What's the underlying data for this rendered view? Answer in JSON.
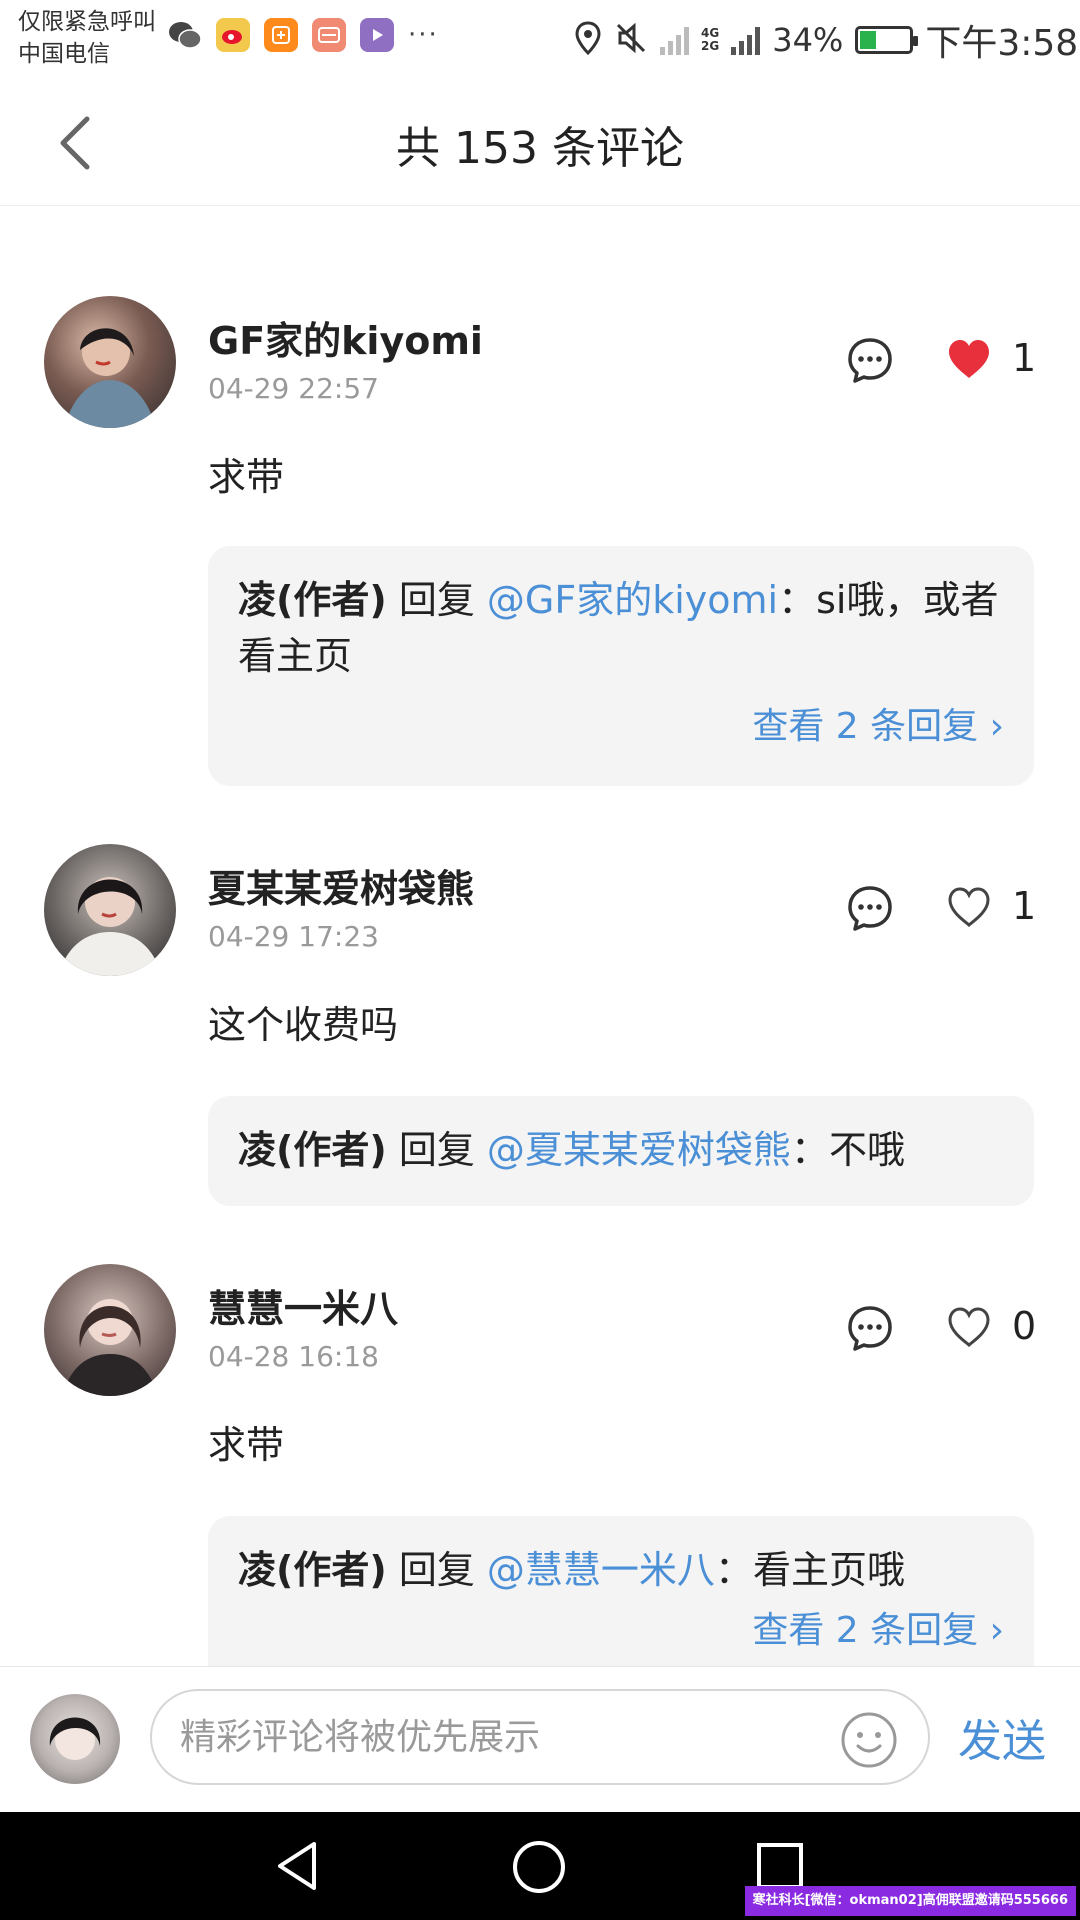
{
  "status_bar": {
    "carrier_line1": "仅限紧急呼叫",
    "carrier_line2": "中国电信",
    "notification_icons": [
      "wechat-icon",
      "weibo-icon",
      "taobao-icon",
      "mail-app-icon",
      "video-app-icon"
    ],
    "more_dots": "···",
    "network_label_top": "4G",
    "network_label_bottom": "2G",
    "battery_percent": "34%",
    "battery_level": 0.34,
    "time": "下午3:58"
  },
  "header": {
    "title": "共 153 条评论"
  },
  "comments": [
    {
      "username": "GF家的kiyomi",
      "time": "04-29 22:57",
      "text": "求带",
      "liked": true,
      "like_count": "1",
      "reply": {
        "author": "凌(作者)",
        "verb": " 回复 ",
        "mention": "@GF家的kiyomi",
        "colon": "：",
        "content": "si哦，或者看主页",
        "more": "查看 2 条回复 ›"
      }
    },
    {
      "username": "夏某某爱树袋熊",
      "time": "04-29 17:23",
      "text": "这个收费吗",
      "liked": false,
      "like_count": "1",
      "reply": {
        "author": "凌(作者)",
        "verb": " 回复 ",
        "mention": "@夏某某爱树袋熊",
        "colon": "：",
        "content": "不哦"
      }
    },
    {
      "username": "慧慧一米八",
      "time": "04-28 16:18",
      "text": "求带",
      "liked": false,
      "like_count": "0",
      "reply": {
        "author": "凌(作者)",
        "verb": " 回复 ",
        "mention": "@慧慧一米八",
        "colon": "：",
        "content": "看主页哦",
        "more": "查看 2 条回复 ›"
      }
    }
  ],
  "input_bar": {
    "placeholder": "精彩评论将被优先展示",
    "send_label": "发送"
  },
  "watermark": "寒社科长[微信：okman02]高佣联盟邀请码555666",
  "colors": {
    "link": "#4b8fd6",
    "like_active": "#e8303c",
    "reply_bg": "#f4f4f4",
    "nav_bg": "#000000"
  }
}
